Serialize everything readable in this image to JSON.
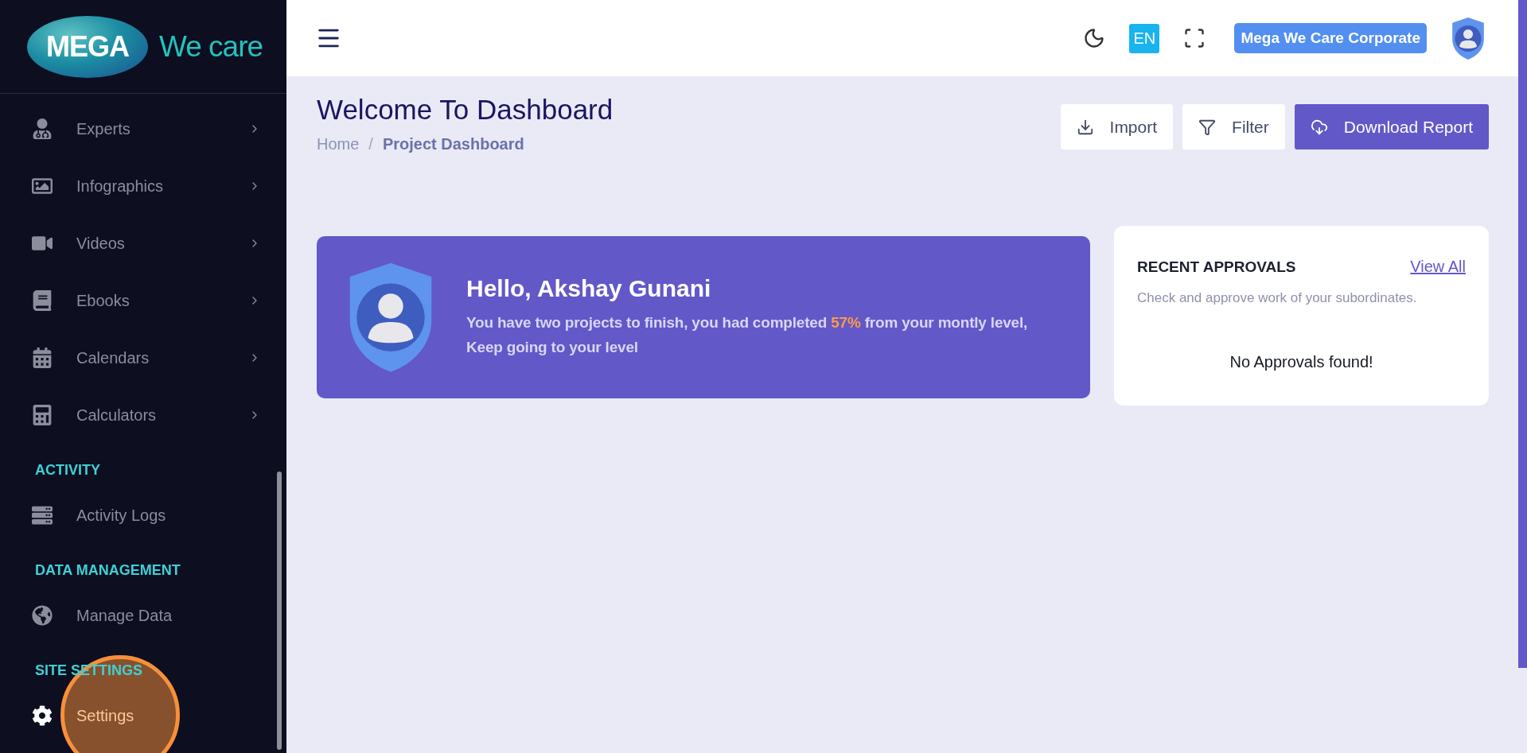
{
  "logo": {
    "badge": "MEGA",
    "tagline": "We care"
  },
  "sidebar": {
    "groups": [
      {
        "items": [
          {
            "label": "Experts",
            "has_submenu": true,
            "click_marker": false
          },
          {
            "label": "Infographics",
            "has_submenu": true,
            "click_marker": false
          },
          {
            "label": "Videos",
            "has_submenu": true,
            "click_marker": false
          },
          {
            "label": "Ebooks",
            "has_submenu": true,
            "click_marker": false
          },
          {
            "label": "Calendars",
            "has_submenu": true,
            "click_marker": false
          },
          {
            "label": "Calculators",
            "has_submenu": true,
            "click_marker": false
          }
        ]
      },
      {
        "heading": "ACTIVITY",
        "items": [
          {
            "label": "Activity Logs",
            "has_submenu": false,
            "click_marker": false
          }
        ]
      },
      {
        "heading": "DATA MANAGEMENT",
        "items": [
          {
            "label": "Manage Data",
            "has_submenu": false,
            "click_marker": false
          }
        ]
      },
      {
        "heading": "SITE SETTINGS",
        "items": [
          {
            "label": "Settings",
            "has_submenu": false,
            "click_marker": true
          }
        ]
      }
    ]
  },
  "header": {
    "language": "EN",
    "company": "Mega We Care Corporate"
  },
  "page": {
    "title": "Welcome To Dashboard",
    "breadcrumb_separator": "/",
    "breadcrumb": [
      {
        "label": "Home",
        "current": false
      },
      {
        "label": "Project Dashboard",
        "current": true
      }
    ],
    "actions": [
      {
        "label": "Import",
        "kind": "import"
      },
      {
        "label": "Filter",
        "kind": "filter"
      },
      {
        "label": "Download Report",
        "kind": "download"
      }
    ]
  },
  "welcome": {
    "greeting": "Hello, Akshay Gunani",
    "message": "You have two projects to finish, you had completed **57%** from your montly level, Keep going to your level"
  },
  "approvals": {
    "title": "RECENT APPROVALS",
    "link": "View All",
    "subtitle": "Check and approve work of your subordinates.",
    "empty": "No Approvals found!"
  }
}
